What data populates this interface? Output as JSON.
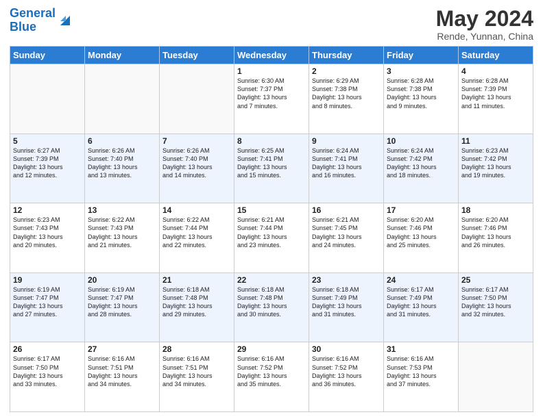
{
  "header": {
    "logo_line1": "General",
    "logo_line2": "Blue",
    "month_year": "May 2024",
    "location": "Rende, Yunnan, China"
  },
  "days_of_week": [
    "Sunday",
    "Monday",
    "Tuesday",
    "Wednesday",
    "Thursday",
    "Friday",
    "Saturday"
  ],
  "weeks": [
    [
      {
        "num": "",
        "info": ""
      },
      {
        "num": "",
        "info": ""
      },
      {
        "num": "",
        "info": ""
      },
      {
        "num": "1",
        "info": "Sunrise: 6:30 AM\nSunset: 7:37 PM\nDaylight: 13 hours\nand 7 minutes."
      },
      {
        "num": "2",
        "info": "Sunrise: 6:29 AM\nSunset: 7:38 PM\nDaylight: 13 hours\nand 8 minutes."
      },
      {
        "num": "3",
        "info": "Sunrise: 6:28 AM\nSunset: 7:38 PM\nDaylight: 13 hours\nand 9 minutes."
      },
      {
        "num": "4",
        "info": "Sunrise: 6:28 AM\nSunset: 7:39 PM\nDaylight: 13 hours\nand 11 minutes."
      }
    ],
    [
      {
        "num": "5",
        "info": "Sunrise: 6:27 AM\nSunset: 7:39 PM\nDaylight: 13 hours\nand 12 minutes."
      },
      {
        "num": "6",
        "info": "Sunrise: 6:26 AM\nSunset: 7:40 PM\nDaylight: 13 hours\nand 13 minutes."
      },
      {
        "num": "7",
        "info": "Sunrise: 6:26 AM\nSunset: 7:40 PM\nDaylight: 13 hours\nand 14 minutes."
      },
      {
        "num": "8",
        "info": "Sunrise: 6:25 AM\nSunset: 7:41 PM\nDaylight: 13 hours\nand 15 minutes."
      },
      {
        "num": "9",
        "info": "Sunrise: 6:24 AM\nSunset: 7:41 PM\nDaylight: 13 hours\nand 16 minutes."
      },
      {
        "num": "10",
        "info": "Sunrise: 6:24 AM\nSunset: 7:42 PM\nDaylight: 13 hours\nand 18 minutes."
      },
      {
        "num": "11",
        "info": "Sunrise: 6:23 AM\nSunset: 7:42 PM\nDaylight: 13 hours\nand 19 minutes."
      }
    ],
    [
      {
        "num": "12",
        "info": "Sunrise: 6:23 AM\nSunset: 7:43 PM\nDaylight: 13 hours\nand 20 minutes."
      },
      {
        "num": "13",
        "info": "Sunrise: 6:22 AM\nSunset: 7:43 PM\nDaylight: 13 hours\nand 21 minutes."
      },
      {
        "num": "14",
        "info": "Sunrise: 6:22 AM\nSunset: 7:44 PM\nDaylight: 13 hours\nand 22 minutes."
      },
      {
        "num": "15",
        "info": "Sunrise: 6:21 AM\nSunset: 7:44 PM\nDaylight: 13 hours\nand 23 minutes."
      },
      {
        "num": "16",
        "info": "Sunrise: 6:21 AM\nSunset: 7:45 PM\nDaylight: 13 hours\nand 24 minutes."
      },
      {
        "num": "17",
        "info": "Sunrise: 6:20 AM\nSunset: 7:46 PM\nDaylight: 13 hours\nand 25 minutes."
      },
      {
        "num": "18",
        "info": "Sunrise: 6:20 AM\nSunset: 7:46 PM\nDaylight: 13 hours\nand 26 minutes."
      }
    ],
    [
      {
        "num": "19",
        "info": "Sunrise: 6:19 AM\nSunset: 7:47 PM\nDaylight: 13 hours\nand 27 minutes."
      },
      {
        "num": "20",
        "info": "Sunrise: 6:19 AM\nSunset: 7:47 PM\nDaylight: 13 hours\nand 28 minutes."
      },
      {
        "num": "21",
        "info": "Sunrise: 6:18 AM\nSunset: 7:48 PM\nDaylight: 13 hours\nand 29 minutes."
      },
      {
        "num": "22",
        "info": "Sunrise: 6:18 AM\nSunset: 7:48 PM\nDaylight: 13 hours\nand 30 minutes."
      },
      {
        "num": "23",
        "info": "Sunrise: 6:18 AM\nSunset: 7:49 PM\nDaylight: 13 hours\nand 31 minutes."
      },
      {
        "num": "24",
        "info": "Sunrise: 6:17 AM\nSunset: 7:49 PM\nDaylight: 13 hours\nand 31 minutes."
      },
      {
        "num": "25",
        "info": "Sunrise: 6:17 AM\nSunset: 7:50 PM\nDaylight: 13 hours\nand 32 minutes."
      }
    ],
    [
      {
        "num": "26",
        "info": "Sunrise: 6:17 AM\nSunset: 7:50 PM\nDaylight: 13 hours\nand 33 minutes."
      },
      {
        "num": "27",
        "info": "Sunrise: 6:16 AM\nSunset: 7:51 PM\nDaylight: 13 hours\nand 34 minutes."
      },
      {
        "num": "28",
        "info": "Sunrise: 6:16 AM\nSunset: 7:51 PM\nDaylight: 13 hours\nand 34 minutes."
      },
      {
        "num": "29",
        "info": "Sunrise: 6:16 AM\nSunset: 7:52 PM\nDaylight: 13 hours\nand 35 minutes."
      },
      {
        "num": "30",
        "info": "Sunrise: 6:16 AM\nSunset: 7:52 PM\nDaylight: 13 hours\nand 36 minutes."
      },
      {
        "num": "31",
        "info": "Sunrise: 6:16 AM\nSunset: 7:53 PM\nDaylight: 13 hours\nand 37 minutes."
      },
      {
        "num": "",
        "info": ""
      }
    ]
  ]
}
